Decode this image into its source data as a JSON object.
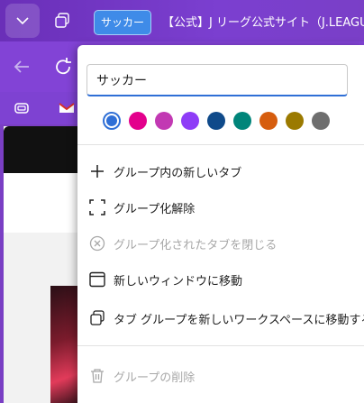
{
  "browser": {
    "group_chip_label": "サッカー",
    "site_tab_title": "【公式】J リーグ公式サイト（J.LEAGUE.jp）"
  },
  "popup": {
    "group_name_value": "サッカー",
    "colors": [
      "#2f6fd6",
      "#e3008c",
      "#c239b3",
      "#8e3cf7",
      "#0f4a8a",
      "#00857a",
      "#d65d0e",
      "#9b7a00",
      "#6e6e6e"
    ],
    "selected_color_index": 0,
    "items": [
      {
        "label": "グループ内の新しいタブ",
        "icon": "plus-icon",
        "enabled": true
      },
      {
        "label": "グループ化解除",
        "icon": "ungroup-icon",
        "enabled": true
      },
      {
        "label": "グループ化されたタブを閉じる",
        "icon": "close-circle-icon",
        "enabled": false
      },
      {
        "label": "新しいウィンドウに移動",
        "icon": "window-icon",
        "enabled": true
      },
      {
        "label": "タブ グループを新しいワークスペースに移動する",
        "icon": "workspaces-icon",
        "enabled": true
      },
      {
        "label": "グループの削除",
        "icon": "trash-icon",
        "enabled": false
      }
    ]
  }
}
